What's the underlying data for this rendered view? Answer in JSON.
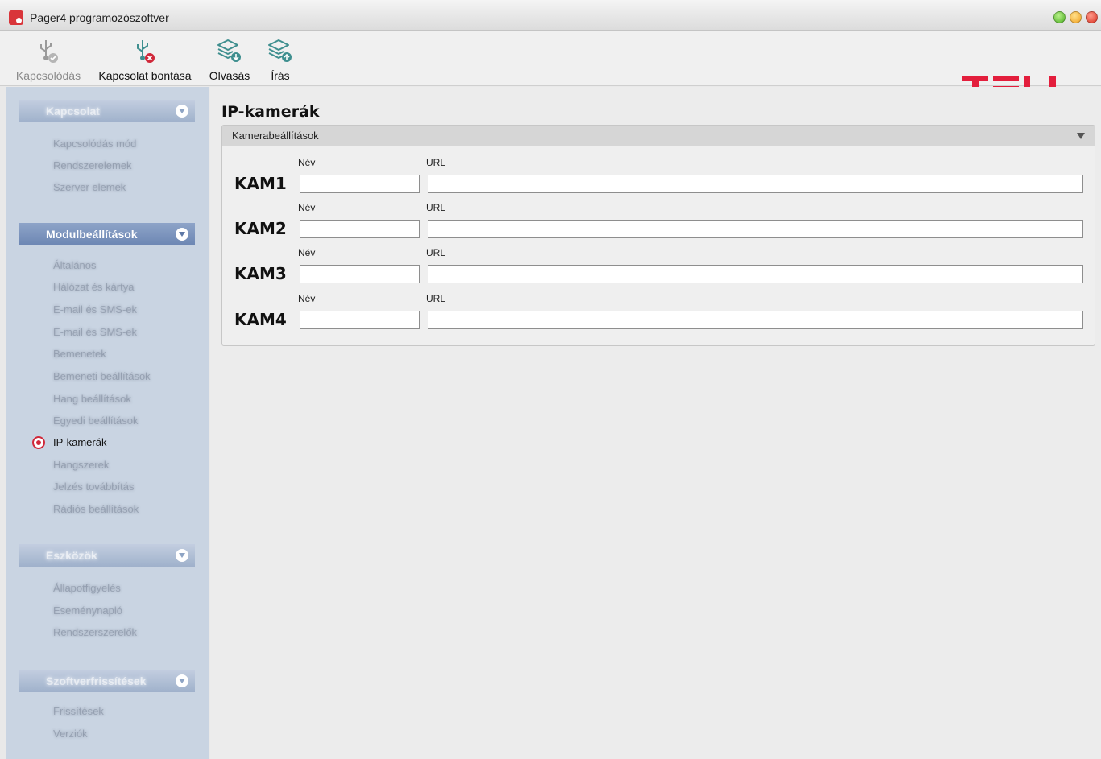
{
  "window": {
    "title": "Pager4 programozószoftver"
  },
  "toolbar": {
    "connect_label": "Kapcsolódás",
    "disconnect_label": "Kapcsolat bontása",
    "read_label": "Olvasás",
    "write_label": "Írás",
    "brand": "TELL"
  },
  "sidebar": {
    "groups": [
      {
        "label": "Kapcsolat",
        "items": [
          "Kapcsolódás mód",
          "Rendszerelemek",
          "Szerver elemek"
        ]
      },
      {
        "label": "Modulbeállítások",
        "items": [
          "Általános",
          "Hálózat és kártya",
          "E-mail és SMS-ek",
          "E-mail és SMS-ek",
          "Bemenetek",
          "Bemeneti beállítások",
          "Hang beállítások",
          "Egyedi beállítások",
          "IP-kamerák",
          "Hangszerek",
          "Jelzés továbbítás",
          "Rádiós beállítások"
        ],
        "selected": "IP-kamerák"
      },
      {
        "label": "Eszközök",
        "items": [
          "Állapotfigyelés",
          "Eseménynapló",
          "Rendszerszerelők"
        ]
      },
      {
        "label": "Szoftverfrissítések",
        "items": [
          "Frissítések",
          "Verziók"
        ]
      }
    ]
  },
  "main": {
    "title": "IP-kamerák",
    "panel_title": "Kamerabeállítások",
    "name_label": "Név",
    "url_label": "URL",
    "cameras": [
      {
        "label": "KAM1",
        "name": "",
        "url": ""
      },
      {
        "label": "KAM2",
        "name": "",
        "url": ""
      },
      {
        "label": "KAM3",
        "name": "",
        "url": ""
      },
      {
        "label": "KAM4",
        "name": "",
        "url": ""
      }
    ]
  },
  "colors": {
    "accent": "#d0283a",
    "sidebar_bg": "#c9d4e2",
    "sidebar_header_active": "#7a92bd",
    "icon_teal": "#3f8f8f"
  }
}
